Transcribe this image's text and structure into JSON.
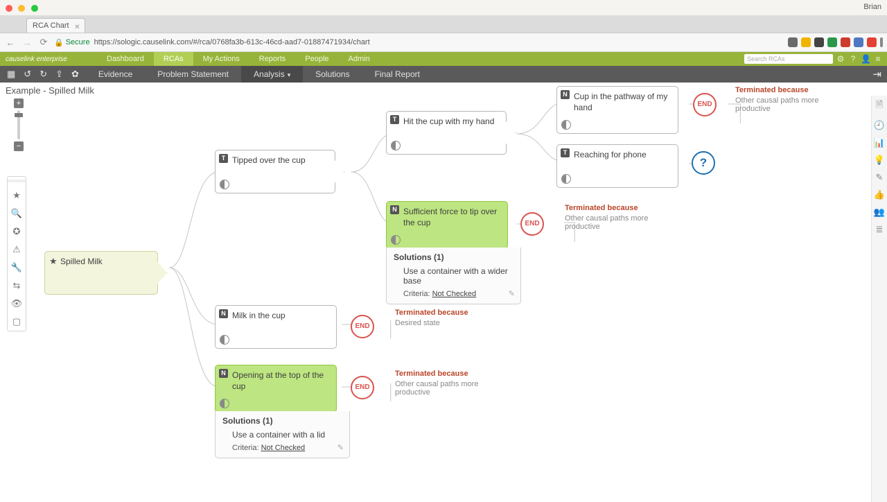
{
  "mac": {
    "user": "Brian"
  },
  "browser": {
    "tab_title": "RCA Chart",
    "secure_label": "Secure",
    "url": "https://sologic.causelink.com/#/rca/0768fa3b-613c-46cd-aad7-01887471934/chart"
  },
  "app": {
    "brand": "causelink enterprise",
    "nav": [
      "Dashboard",
      "RCAs",
      "My Actions",
      "Reports",
      "People",
      "Admin"
    ],
    "nav_active": 1,
    "search_placeholder": "Search RCAs"
  },
  "toolbar": {
    "items": [
      "Evidence",
      "Problem Statement",
      "Analysis",
      "Solutions",
      "Final Report"
    ],
    "active": 2
  },
  "crumb": "Example - Spilled Milk",
  "nodes": {
    "root": {
      "label": "Spilled Milk"
    },
    "tip": {
      "tag": "T",
      "label": "Tipped over the cup"
    },
    "hit": {
      "tag": "T",
      "label": "Hit the cup with my hand"
    },
    "path": {
      "tag": "N",
      "label": "Cup in the pathway of my hand"
    },
    "reach": {
      "tag": "T",
      "label": "Reaching for phone"
    },
    "force": {
      "tag": "N",
      "label": "Sufficient force to tip over the cup"
    },
    "milk": {
      "tag": "N",
      "label": "Milk in the cup"
    },
    "open": {
      "tag": "N",
      "label": "Opening at the top of the cup"
    }
  },
  "end_label": "END",
  "question_label": "?",
  "terminations": {
    "path": {
      "head": "Terminated because",
      "body": "Other causal paths more productive"
    },
    "force": {
      "head": "Terminated because",
      "body": "Other causal paths more productive"
    },
    "milk": {
      "head": "Terminated because",
      "body": "Desired state"
    },
    "open": {
      "head": "Terminated because",
      "body": "Other causal paths more productive"
    }
  },
  "solutions": {
    "force": {
      "header": "Solutions (1)",
      "text": "Use a container with a wider base",
      "criteria_label": "Criteria:",
      "criteria_value": "Not Checked"
    },
    "open": {
      "header": "Solutions (1)",
      "text": "Use a container with a lid",
      "criteria_label": "Criteria:",
      "criteria_value": "Not Checked"
    }
  }
}
